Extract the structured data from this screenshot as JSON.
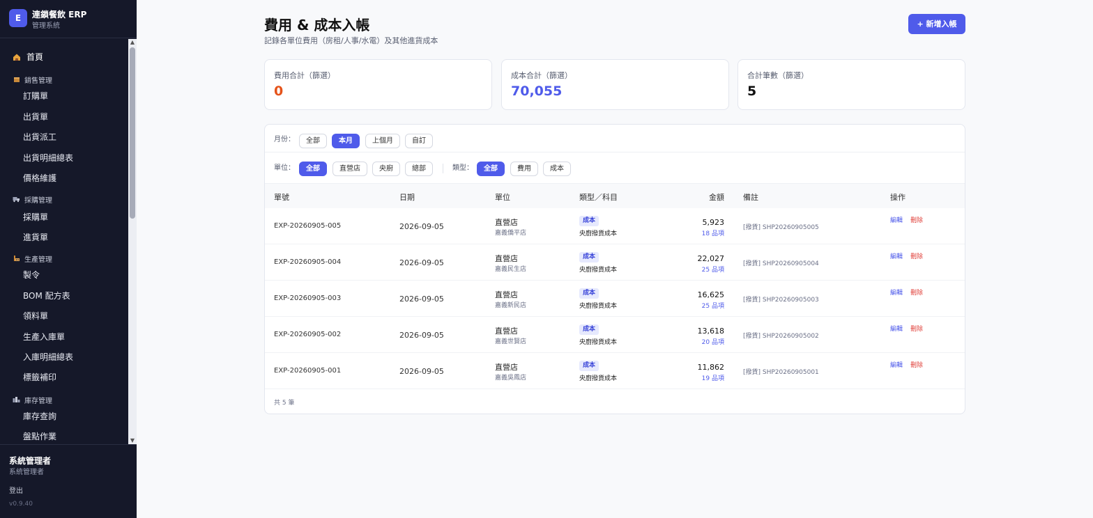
{
  "brand": {
    "logo_letter": "E",
    "title": "連鎖餐飲 ERP",
    "subtitle": "管理系統"
  },
  "nav": {
    "home": {
      "icon": "home-icon",
      "label": "首頁"
    },
    "groups": {
      "sales": {
        "icon": "box-icon",
        "label": "銷售管理"
      },
      "purchase": {
        "icon": "truck-icon",
        "label": "採購管理"
      },
      "production": {
        "icon": "factory-icon",
        "label": "生產管理"
      },
      "inventory": {
        "icon": "warehouse-icon",
        "label": "庫存管理"
      }
    },
    "items": {
      "order": "訂購單",
      "shipment": "出貨單",
      "dispatch": "出貨派工",
      "shipment_detail": "出貨明細總表",
      "price": "價格維護",
      "po": "採購單",
      "receiving": "進貨單",
      "work_order": "製令",
      "bom": "BOM 配方表",
      "material": "領料單",
      "prod_in": "生產入庫單",
      "in_detail": "入庫明細總表",
      "label_print": "標籤補印",
      "stock_query": "庫存查詢",
      "stocktake": "盤點作業"
    }
  },
  "user": {
    "name": "系統管理者",
    "role": "系統管理者",
    "logout": "登出",
    "version": "v0.9.40"
  },
  "header": {
    "title": "費用 & 成本入帳",
    "subtitle": "記錄各單位費用（房租/人事/水電）及其他進貨成本",
    "add_button": "+ 新增入帳"
  },
  "summary": [
    {
      "label": "費用合計（篩選）",
      "value": "0",
      "color": "#e5531a"
    },
    {
      "label": "成本合計（篩選）",
      "value": "70,055",
      "color": "#4f5bea"
    },
    {
      "label": "合計筆數（篩選）",
      "value": "5",
      "color": "#111111"
    }
  ],
  "filters": {
    "month_label": "月份：",
    "month_options": [
      "全部",
      "本月",
      "上個月",
      "自訂"
    ],
    "month_selected": "本月",
    "unit_label": "單位：",
    "unit_options": [
      "全部",
      "直營店",
      "央廚",
      "總部"
    ],
    "unit_selected": "全部",
    "type_label": "類型：",
    "type_options": [
      "全部",
      "費用",
      "成本"
    ],
    "type_selected": "全部"
  },
  "table": {
    "headers": {
      "no": "單號",
      "date": "日期",
      "unit": "單位",
      "type": "類型／科目",
      "amount": "金額",
      "note": "備註",
      "action": "操作"
    },
    "rows": [
      {
        "no": "EXP-20260905-005",
        "date": "2026-09-05",
        "unit": "直營店",
        "store": "嘉義僑平店",
        "badge": "成本",
        "category": "央廚撥貨成本",
        "amount": "5,923",
        "items": "18 品項",
        "note": "[撥貨] SHP20260905005",
        "edit": "編輯",
        "delete": "刪除"
      },
      {
        "no": "EXP-20260905-004",
        "date": "2026-09-05",
        "unit": "直營店",
        "store": "嘉義民生店",
        "badge": "成本",
        "category": "央廚撥貨成本",
        "amount": "22,027",
        "items": "25 品項",
        "note": "[撥貨] SHP20260905004",
        "edit": "編輯",
        "delete": "刪除"
      },
      {
        "no": "EXP-20260905-003",
        "date": "2026-09-05",
        "unit": "直營店",
        "store": "嘉義新民店",
        "badge": "成本",
        "category": "央廚撥貨成本",
        "amount": "16,625",
        "items": "25 品項",
        "note": "[撥貨] SHP20260905003",
        "edit": "編輯",
        "delete": "刪除"
      },
      {
        "no": "EXP-20260905-002",
        "date": "2026-09-05",
        "unit": "直營店",
        "store": "嘉義世賢店",
        "badge": "成本",
        "category": "央廚撥貨成本",
        "amount": "13,618",
        "items": "20 品項",
        "note": "[撥貨] SHP20260905002",
        "edit": "編輯",
        "delete": "刪除"
      },
      {
        "no": "EXP-20260905-001",
        "date": "2026-09-05",
        "unit": "直營店",
        "store": "嘉義吳鳳店",
        "badge": "成本",
        "category": "央廚撥貨成本",
        "amount": "11,862",
        "items": "19 品項",
        "note": "[撥貨] SHP20260905001",
        "edit": "編輯",
        "delete": "刪除"
      }
    ],
    "footer": "共 5 筆"
  }
}
